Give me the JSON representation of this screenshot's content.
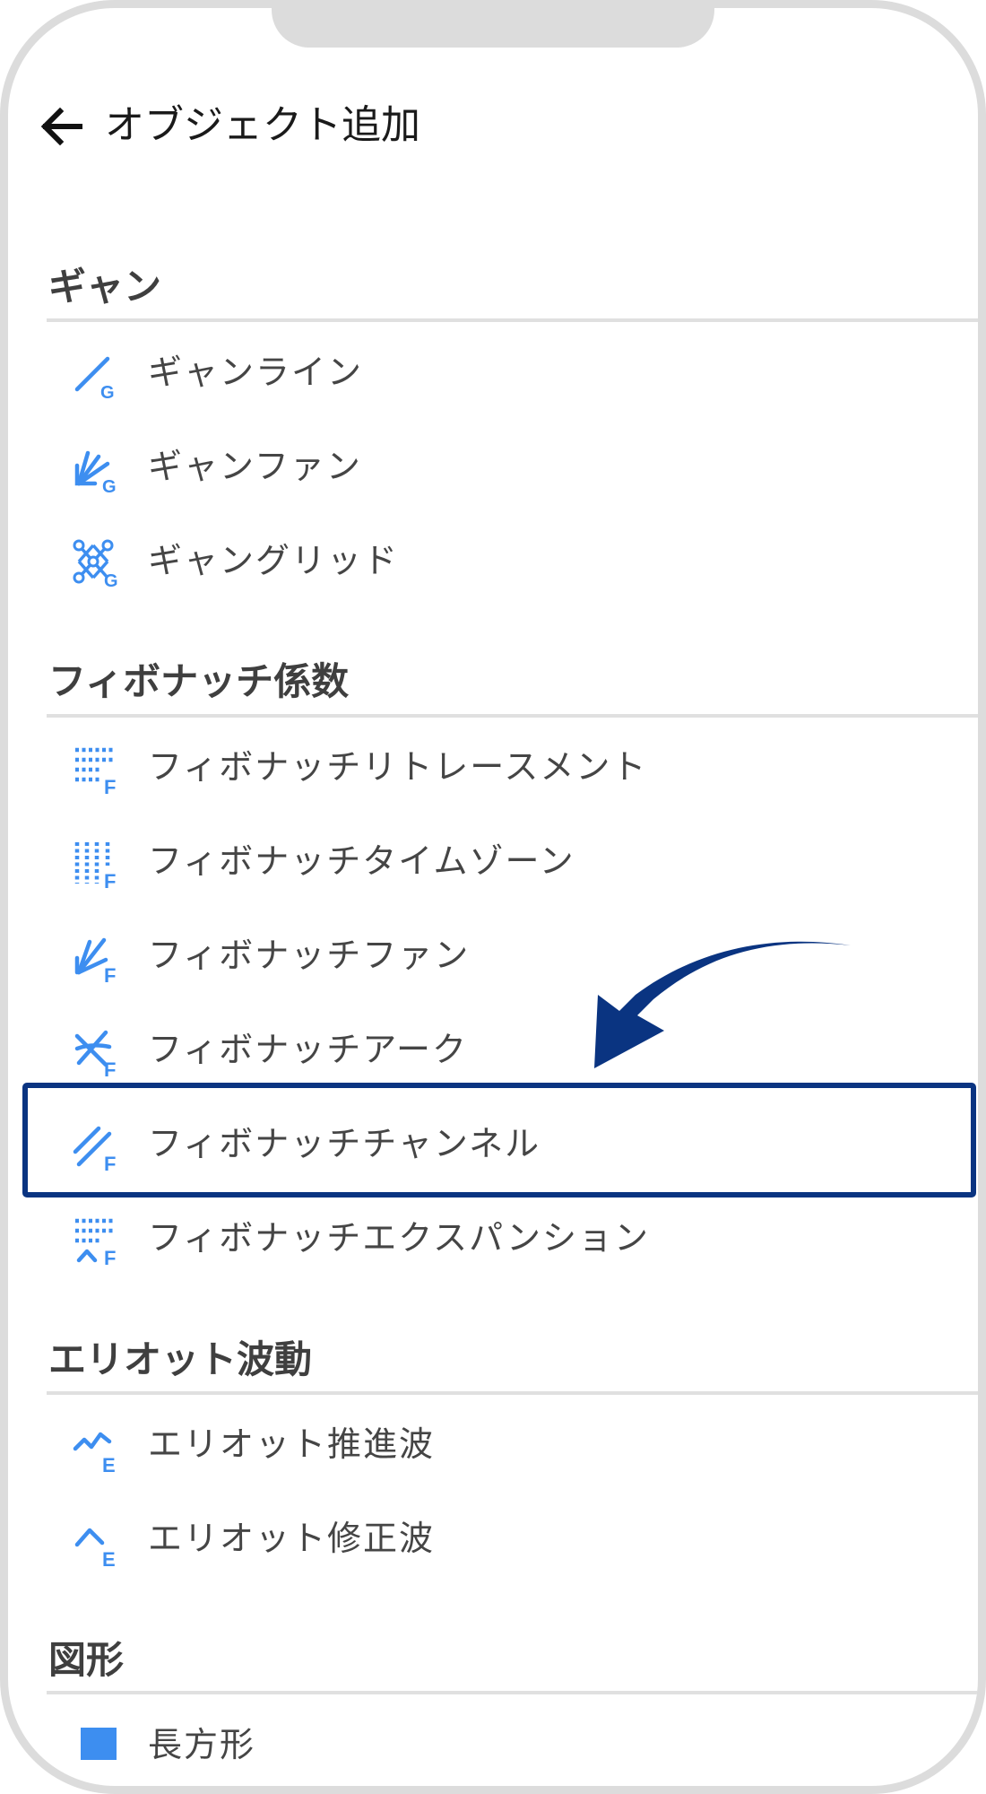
{
  "header": {
    "title": "オブジェクト追加",
    "back_icon": "arrow-left-icon"
  },
  "sections": [
    {
      "id": "gann",
      "title": "ギャン",
      "items": [
        {
          "label": "ギャンライン",
          "icon": "gann-line-icon",
          "icon_letter": "G"
        },
        {
          "label": "ギャンファン",
          "icon": "gann-fan-icon",
          "icon_letter": "G"
        },
        {
          "label": "ギャングリッド",
          "icon": "gann-grid-icon",
          "icon_letter": "G"
        }
      ]
    },
    {
      "id": "fibonacci",
      "title": "フィボナッチ係数",
      "items": [
        {
          "label": "フィボナッチリトレースメント",
          "icon": "fibonacci-retracement-icon",
          "icon_letter": "F"
        },
        {
          "label": "フィボナッチタイムゾーン",
          "icon": "fibonacci-timezone-icon",
          "icon_letter": "F"
        },
        {
          "label": "フィボナッチファン",
          "icon": "fibonacci-fan-icon",
          "icon_letter": "F"
        },
        {
          "label": "フィボナッチアーク",
          "icon": "fibonacci-arc-icon",
          "icon_letter": "F"
        },
        {
          "label": "フィボナッチチャンネル",
          "icon": "fibonacci-channel-icon",
          "icon_letter": "F",
          "highlighted": true
        },
        {
          "label": "フィボナッチエクスパンション",
          "icon": "fibonacci-expansion-icon",
          "icon_letter": "F"
        }
      ]
    },
    {
      "id": "elliott",
      "title": "エリオット波動",
      "items": [
        {
          "label": "エリオット推進波",
          "icon": "elliott-impulse-wave-icon",
          "icon_letter": "E"
        },
        {
          "label": "エリオット修正波",
          "icon": "elliott-corrective-wave-icon",
          "icon_letter": "E"
        }
      ]
    },
    {
      "id": "shapes",
      "title": "図形",
      "items": [
        {
          "label": "長方形",
          "icon": "rectangle-icon",
          "icon_letter": ""
        }
      ]
    }
  ],
  "annotation": {
    "arrow_icon": "curved-arrow-icon",
    "color": "#0a3481"
  },
  "colors": {
    "accent": "#3d8ef0",
    "highlight": "#0a3481",
    "frame": "#dcdcdc",
    "text": "#454545"
  }
}
